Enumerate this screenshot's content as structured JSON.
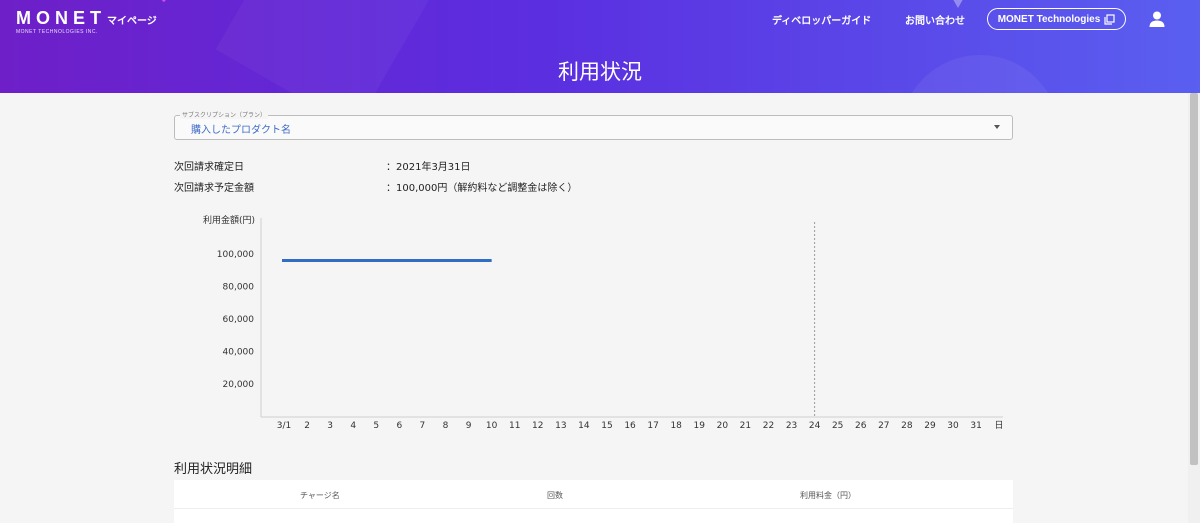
{
  "header": {
    "logo_text": "MONET",
    "logo_subtext": "MONET TECHNOLOGIES INC.",
    "nav_mypage": "マイページ",
    "nav_developer_guide": "ディベロッパーガイド",
    "nav_contact": "お問い合わせ",
    "nav_monet_button": "MONET Technologies",
    "page_title": "利用状況",
    "icons": {
      "external": "external-link-icon",
      "user": "user-icon"
    },
    "colors": {
      "gradient_start": "#6e1fc8",
      "gradient_end": "#5a5ff0"
    }
  },
  "subscription": {
    "legend": "サブスクリプション（プラン）",
    "selected": "購入したプロダクト名"
  },
  "billing": {
    "next_date_label": "次回請求確定日",
    "next_date_value": "：2021年3月31日",
    "next_amount_label": "次回請求予定金額",
    "next_amount_value": "：100,000円（解約料など調整金は除く）"
  },
  "chart_data": {
    "type": "line",
    "ylabel": "利用金額(円)",
    "xlabel": "日",
    "y_ticks": [
      100000,
      80000,
      60000,
      40000,
      20000
    ],
    "y_tick_labels": [
      "100,000",
      "80,000",
      "60,000",
      "40,000",
      "20,000"
    ],
    "ylim": [
      0,
      110000
    ],
    "x_tick_labels": [
      "3/1",
      "2",
      "3",
      "4",
      "5",
      "6",
      "7",
      "8",
      "9",
      "10",
      "11",
      "12",
      "13",
      "14",
      "15",
      "16",
      "17",
      "18",
      "19",
      "20",
      "21",
      "22",
      "23",
      "24",
      "25",
      "26",
      "27",
      "28",
      "29",
      "30",
      "31"
    ],
    "series": [
      {
        "values": [
          96000,
          96000,
          96000,
          96000,
          96000,
          96000,
          96000,
          96000,
          96000,
          96000
        ],
        "color": "#2f6ec4"
      }
    ],
    "marker_day": 24,
    "grid": false
  },
  "details": {
    "title": "利用状況明細",
    "columns": [
      "チャージ名",
      "回数",
      "利用料金（円）"
    ]
  }
}
